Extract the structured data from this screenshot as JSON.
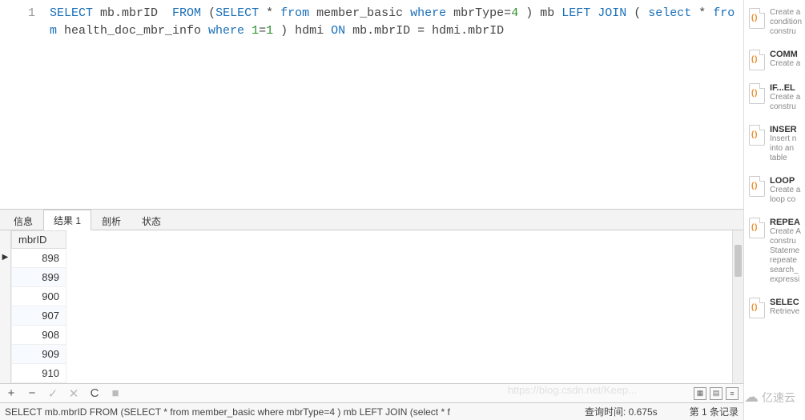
{
  "editor": {
    "line_number": "1",
    "tokens": [
      {
        "t": "SELECT",
        "c": "kw"
      },
      {
        "t": " mb.mbrID  ",
        "c": "ident"
      },
      {
        "t": "FROM",
        "c": "kw"
      },
      {
        "t": " (",
        "c": "ident"
      },
      {
        "t": "SELECT",
        "c": "kw"
      },
      {
        "t": " * ",
        "c": "ident"
      },
      {
        "t": "from",
        "c": "kw"
      },
      {
        "t": " member_basic ",
        "c": "ident"
      },
      {
        "t": "where",
        "c": "kw"
      },
      {
        "t": " mbrType=",
        "c": "ident"
      },
      {
        "t": "4",
        "c": "num"
      },
      {
        "t": " ) mb ",
        "c": "ident"
      },
      {
        "t": "LEFT JOIN",
        "c": "kw"
      },
      {
        "t": " ( ",
        "c": "ident"
      },
      {
        "t": "select",
        "c": "kw"
      },
      {
        "t": " * ",
        "c": "ident"
      },
      {
        "t": "from",
        "c": "kw"
      },
      {
        "t": " health_doc_mbr_info ",
        "c": "ident"
      },
      {
        "t": "where",
        "c": "kw"
      },
      {
        "t": " ",
        "c": "ident"
      },
      {
        "t": "1",
        "c": "num"
      },
      {
        "t": "=",
        "c": "ident"
      },
      {
        "t": "1",
        "c": "num"
      },
      {
        "t": " ) hdmi ",
        "c": "ident"
      },
      {
        "t": "ON",
        "c": "kw"
      },
      {
        "t": " mb.mbrID = hdmi.mbrID",
        "c": "ident"
      }
    ]
  },
  "tabs": {
    "items": [
      "信息",
      "结果 1",
      "剖析",
      "状态"
    ],
    "active_index": 1
  },
  "result": {
    "column": "mbrID",
    "rows": [
      "898",
      "899",
      "900",
      "907",
      "908",
      "909",
      "910"
    ],
    "current_row_index": 0
  },
  "toolbar": {
    "add": "+",
    "remove": "−",
    "accept": "✓",
    "cancel": "✕",
    "refresh": "C",
    "stop": "■"
  },
  "status": {
    "sql_preview": "SELECT mb.mbrID  FROM (SELECT * from member_basic where mbrType=4 ) mb LEFT JOIN (select * f",
    "query_time_label": "查询时间:",
    "query_time_value": "0.675s",
    "record_label": "第 1 条记录"
  },
  "snippets": [
    {
      "title": "",
      "desc": "Create a\ncondition\nconstru"
    },
    {
      "title": "COMM",
      "desc": "Create a"
    },
    {
      "title": "IF...EL",
      "desc": "Create a\nconstru"
    },
    {
      "title": "INSER",
      "desc": "Insert n\ninto an\ntable"
    },
    {
      "title": "LOOP",
      "desc": "Create a\nloop co"
    },
    {
      "title": "REPEA",
      "desc": "Create A\nconstru\nStateme\nrepeate\nsearch_\nexpressi"
    },
    {
      "title": "SELEC",
      "desc": "Retrieve"
    }
  ],
  "watermark": {
    "text": "亿速云",
    "faint": "https://blog.csdn.net/Keep..."
  }
}
